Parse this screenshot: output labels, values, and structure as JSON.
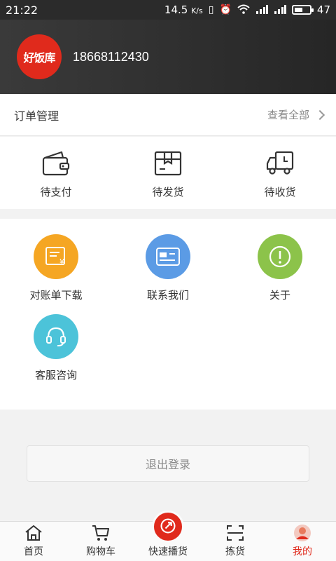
{
  "status_bar": {
    "time": "21:22",
    "speed": "14.5",
    "speed_unit": "K/s",
    "battery": "47"
  },
  "header": {
    "logo_text": "好饭库",
    "phone": "18668112430"
  },
  "orders": {
    "title": "订单管理",
    "view_all": "查看全部",
    "items": [
      {
        "label": "待支付",
        "icon": "wallet-icon"
      },
      {
        "label": "待发货",
        "icon": "box-icon"
      },
      {
        "label": "待收货",
        "icon": "truck-icon"
      }
    ]
  },
  "services": {
    "items": [
      {
        "label": "对账单下载",
        "icon": "bill-icon",
        "color": "#f5a623"
      },
      {
        "label": "联系我们",
        "icon": "card-icon",
        "color": "#5b9be5"
      },
      {
        "label": "关于",
        "icon": "info-icon",
        "color": "#8cc34a"
      },
      {
        "label": "客服咨询",
        "icon": "headset-icon",
        "color": "#4cc3d9"
      }
    ]
  },
  "logout_label": "退出登录",
  "tabs": [
    {
      "label": "首页",
      "icon": "home-icon"
    },
    {
      "label": "购物车",
      "icon": "cart-icon"
    },
    {
      "label": "快速播货",
      "icon": "share-icon"
    },
    {
      "label": "拣货",
      "icon": "scan-icon"
    },
    {
      "label": "我的",
      "icon": "user-icon",
      "active": true
    }
  ],
  "colors": {
    "accent": "#e02a1c",
    "header_bg": "#2e2e2e"
  }
}
